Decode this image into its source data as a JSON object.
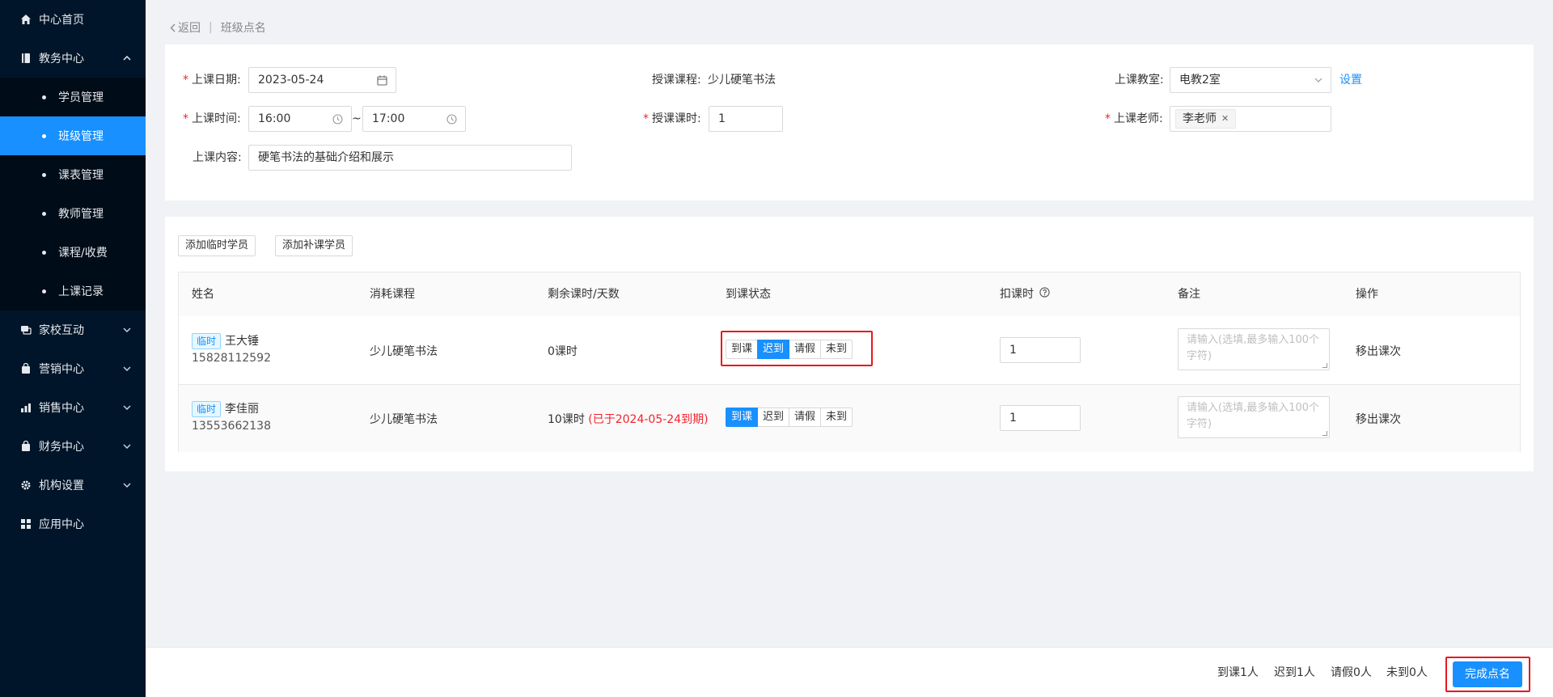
{
  "sidebar": {
    "home": "中心首页",
    "edu": "教务中心",
    "edu_items": [
      "学员管理",
      "班级管理",
      "课表管理",
      "教师管理",
      "课程/收费",
      "上课记录"
    ],
    "home_school": "家校互动",
    "marketing": "营销中心",
    "sales": "销售中心",
    "finance": "财务中心",
    "org": "机构设置",
    "apps": "应用中心"
  },
  "breadcrumb": {
    "back": "返回",
    "current": "班级点名"
  },
  "form": {
    "date_label": "上课日期:",
    "date_value": "2023-05-24",
    "course_label": "授课课程:",
    "course_value": "少儿硬笔书法",
    "room_label": "上课教室:",
    "room_value": "电教2室",
    "room_setting": "设置",
    "time_label": "上课时间:",
    "time_start": "16:00",
    "time_sep": "~",
    "time_end": "17:00",
    "hours_label": "授课课时:",
    "hours_value": "1",
    "teacher_label": "上课老师:",
    "teacher_value": "李老师",
    "content_label": "上课内容:",
    "content_value": "硬笔书法的基础介绍和展示"
  },
  "actions": {
    "add_temp": "添加临时学员",
    "add_makeup": "添加补课学员"
  },
  "table": {
    "headers": [
      "姓名",
      "消耗课程",
      "剩余课时/天数",
      "到课状态",
      "扣课时",
      "备注",
      "操作"
    ],
    "status_options": [
      "到课",
      "迟到",
      "请假",
      "未到"
    ],
    "note_placeholder": "请输入(选填,最多输入100个字符)",
    "rows": [
      {
        "tag": "临时",
        "name": "王大锤",
        "phone": "15828112592",
        "course": "少儿硬笔书法",
        "remaining": "0课时",
        "expired": "",
        "status": "迟到",
        "deduct": "1",
        "op": "移出课次"
      },
      {
        "tag": "临时",
        "name": "李佳丽",
        "phone": "13553662138",
        "course": "少儿硬笔书法",
        "remaining": "10课时",
        "expired": "(已于2024-05-24到期)",
        "status": "到课",
        "deduct": "1",
        "op": "移出课次"
      }
    ]
  },
  "footer": {
    "arrived": "到课1人",
    "late": "迟到1人",
    "leave": "请假0人",
    "absent": "未到0人",
    "complete": "完成点名"
  },
  "colors": {
    "sidebar_bg": "#001529",
    "accent": "#1890ff",
    "highlight": "#e8191e"
  }
}
